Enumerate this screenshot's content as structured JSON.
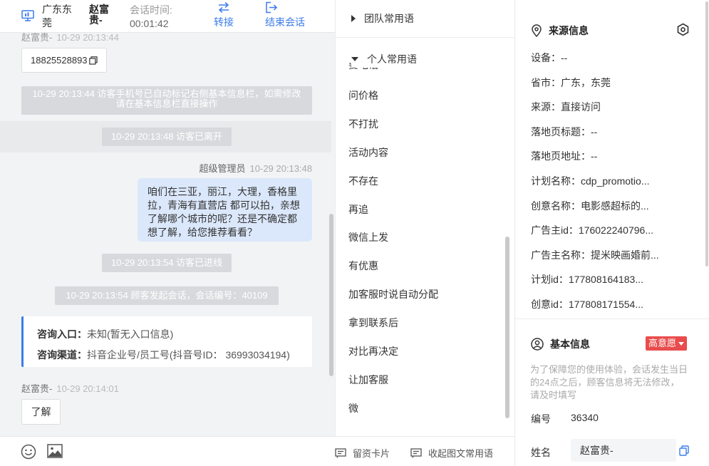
{
  "header": {
    "location": "广东东莞",
    "visitor_name": "赵富贵-",
    "session_time_label": "会话时间:",
    "session_time_value": "00:01:42",
    "transfer_label": "转接",
    "end_label": "结束会话"
  },
  "chat": {
    "top_partial_name": "赵富贵-",
    "top_partial_time": "10-29 20:13:44",
    "phone_card": "18825528893",
    "system_messages": [
      "10-29 20:13:44 访客手机号已自动标记右侧基本信息栏，如需修改请在基本信息栏直接操作",
      "10-29 20:13:48 访客已离开",
      "10-29 20:13:54 访客已进线",
      "10-29 20:13:54 顾客发起会话，会话编号：40109"
    ],
    "agent_name": "超级管理员",
    "agent_time": "10-29 20:13:48",
    "agent_message": "咱们在三亚，丽江，大理，香格里拉，青海有直营店 都可以拍，亲想了解哪个城市的呢？还是不确定都想了解，给您推荐看看？",
    "entry_label": "咨询入口：",
    "entry_value": "未知(暂无入口信息)",
    "channel_label": "咨询渠道：",
    "channel_value": "抖音企业号/员工号(抖音号ID：  36993034194)",
    "visitor_name": "赵富贵-",
    "visitor_time": "10-29 20:14:01",
    "visitor_message": "了解"
  },
  "toolbar": {
    "emoji_icon": "emoji-icon",
    "image_icon": "image-icon",
    "info_card_label": "留资卡片",
    "collapse_label": "收起图文常用语"
  },
  "phrases": {
    "team_group": "团队常用语",
    "personal_group": "个人常用语",
    "partial_item": "要电话",
    "items": [
      "问价格",
      "不打扰",
      "活动内容",
      "不存在",
      "再追",
      "微信上发",
      "有优惠",
      "加客服时说自动分配",
      "拿到联系后",
      "对比再决定",
      "让加客服",
      "微"
    ]
  },
  "info": {
    "source_title": "来源信息",
    "source_rows": [
      "设备：--",
      "省市：广东，东莞",
      "来源：直接访问",
      "落地页标题：--",
      "落地页地址：--",
      "计划名称：cdp_promotio...",
      "创意名称：电影感超标的...",
      "广告主id：176022240796...",
      "广告主名称：提米映画婚前...",
      "计划id：177808164183...",
      "创意id：177808171554..."
    ],
    "basic_title": "基本信息",
    "intent_badge": "高意愿",
    "notice": "为了保障您的使用体验，会话发生当日的24点之后，顾客信息将无法修改，请及时填写",
    "number_label": "编号",
    "number_value": "36340",
    "name_label": "姓名",
    "name_value": "赵富贵-"
  },
  "colors": {
    "accent": "#3b7bea",
    "agent_bubble": "#dbe8fb",
    "system_bg": "#d7d9dc",
    "intent_red": "#e94c4c"
  }
}
